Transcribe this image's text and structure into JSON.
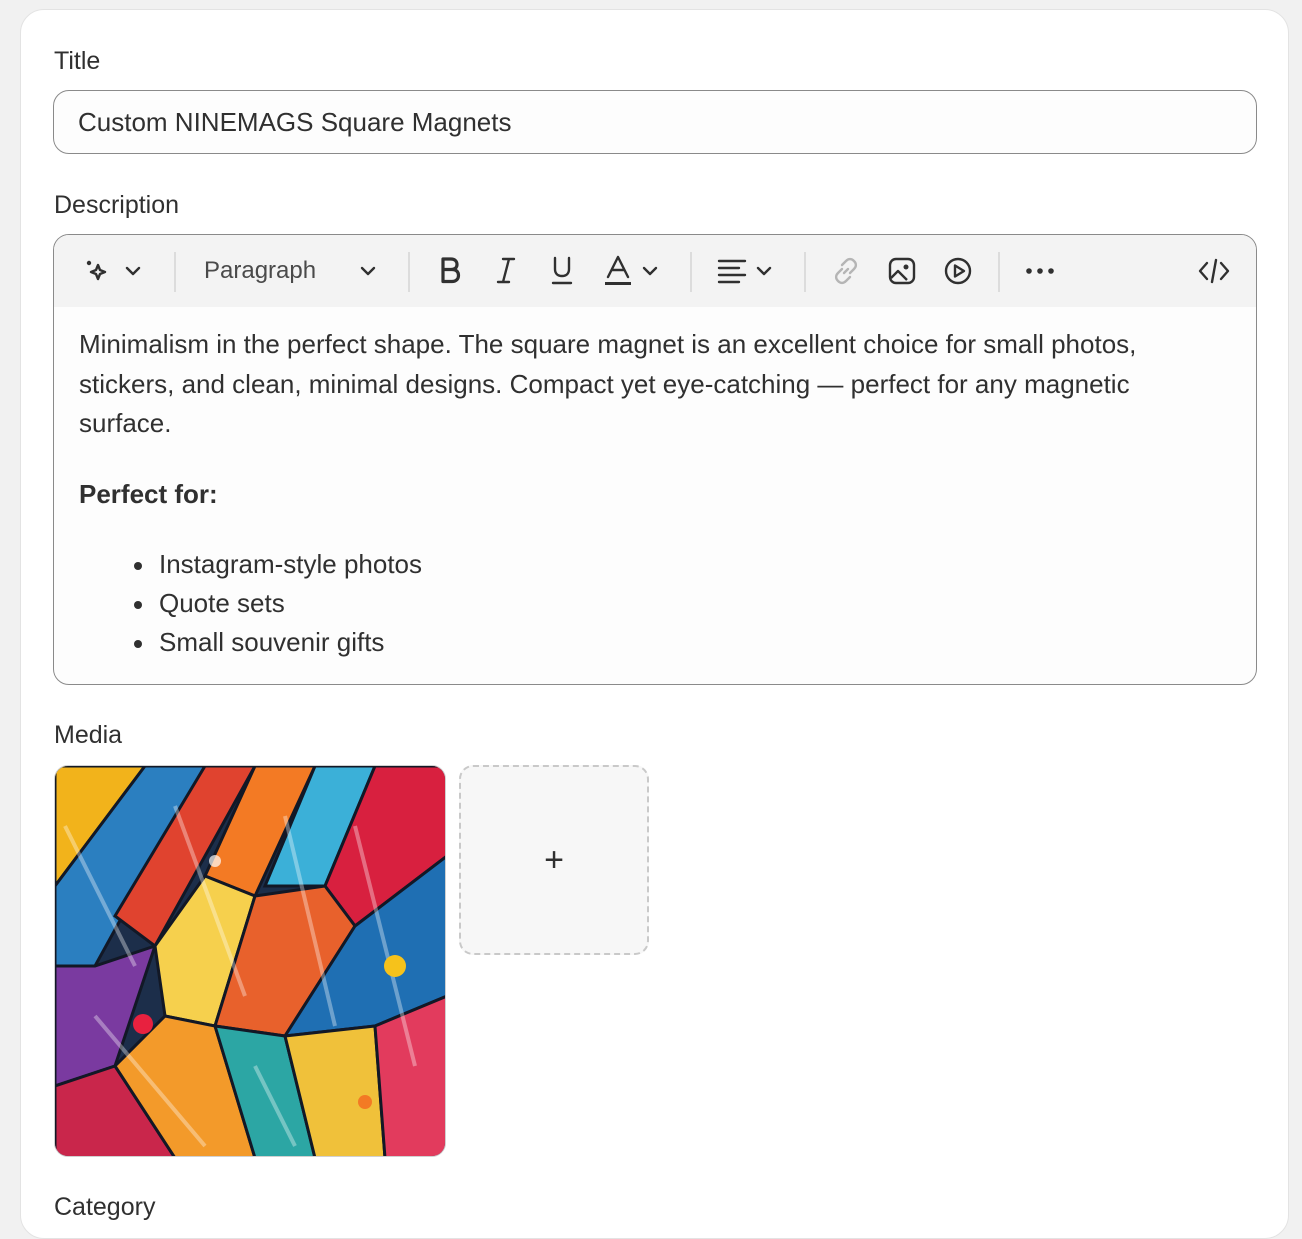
{
  "title_field": {
    "label": "Title",
    "value": "Custom NINEMAGS Square Magnets"
  },
  "description": {
    "label": "Description",
    "toolbar": {
      "block_style": "Paragraph",
      "icons": [
        "magic-icon",
        "chevron-down-icon",
        "bold-icon",
        "italic-icon",
        "underline-icon",
        "text-color-icon",
        "align-icon",
        "link-icon",
        "image-icon",
        "video-icon",
        "more-icon",
        "code-icon"
      ]
    },
    "body": {
      "paragraph": "Minimalism in the perfect shape. The square magnet is an excellent choice for small photos, stickers, and clean, minimal designs. Compact yet eye-catching — perfect for any magnetic surface.",
      "heading": "Perfect for:",
      "bullets": [
        "Instagram-style photos",
        "Quote sets",
        "Small souvenir gifts"
      ]
    }
  },
  "media": {
    "label": "Media",
    "add_label": "+"
  },
  "category": {
    "label": "Category"
  },
  "colors": {
    "border": "#8a8a8a",
    "toolbar_bg": "#f3f3f3",
    "text": "#303030"
  }
}
